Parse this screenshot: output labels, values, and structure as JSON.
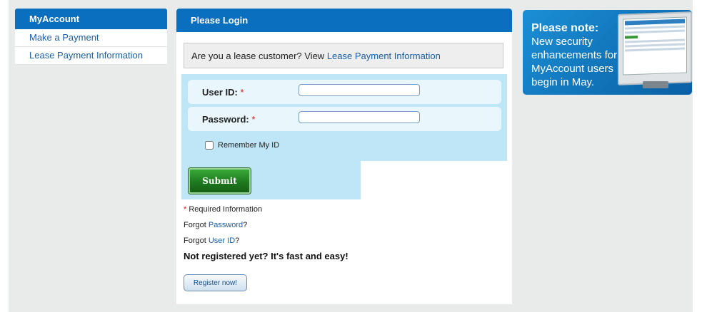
{
  "nav": {
    "title": "MyAccount",
    "items": [
      {
        "label": "Make a Payment"
      },
      {
        "label": "Lease Payment Information"
      }
    ]
  },
  "login": {
    "title": "Please Login",
    "lease_prompt": "Are you a lease customer? View",
    "lease_link": "Lease Payment Information",
    "user_id_label": "User ID:",
    "password_label": "Password:",
    "required_mark": "*",
    "user_id_value": "",
    "password_value": "",
    "remember_label": "Remember My ID",
    "submit_label": "Submit",
    "required_info": "Required Information",
    "forgot_prefix": "Forgot",
    "forgot_password_link": "Password",
    "forgot_userid_link": "User ID",
    "question_mark": "?",
    "not_registered": "Not registered yet? It's fast and easy!",
    "register_label": "Register now!"
  },
  "promo": {
    "heading": "Please note:",
    "body": "New security enhancements for MyAccount users begin in May."
  },
  "colors": {
    "accent": "#0b6fc0",
    "form_bg": "#bfe6f6",
    "submit_green": "#1e7a1e",
    "required_red": "#dd1111"
  }
}
